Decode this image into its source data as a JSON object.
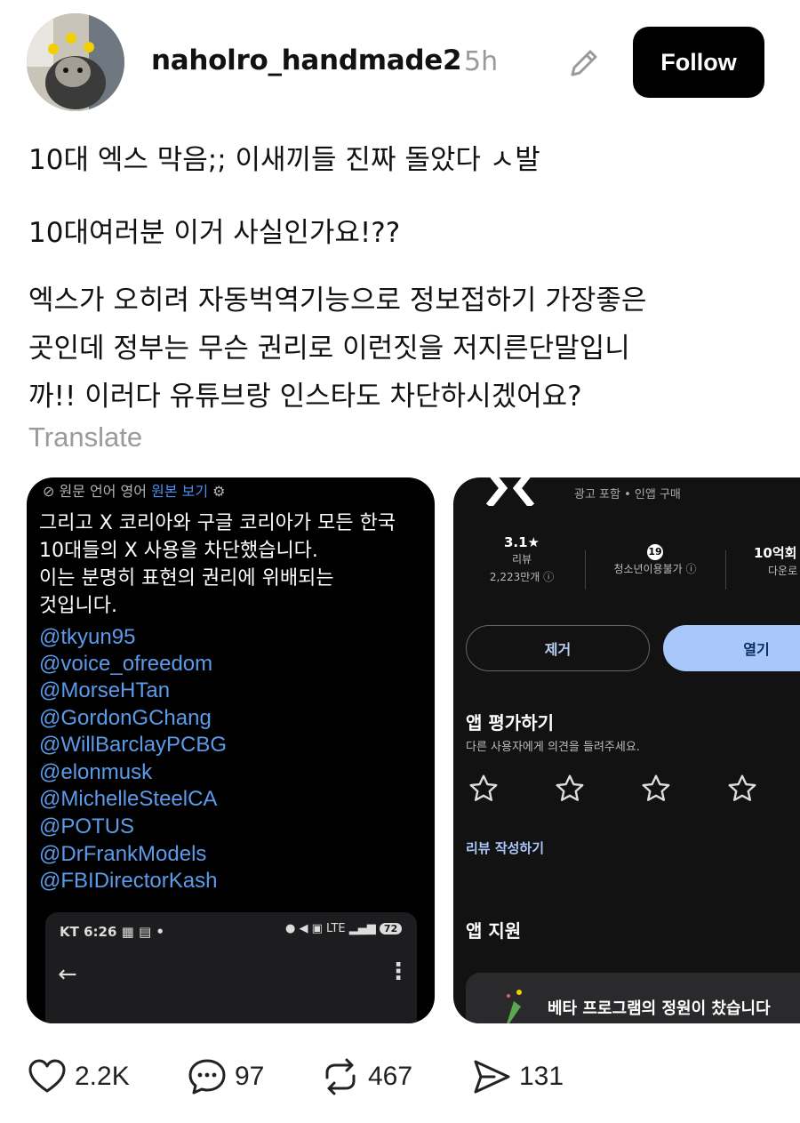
{
  "post": {
    "username": "naholro_handmade2",
    "time": "5h",
    "follow_label": "Follow",
    "lines": [
      "10대 엑스 막음;; 이새끼들 진짜 돌았다 ㅅ발",
      "10대여러분 이거 사실인가요!??"
    ],
    "paragraph": [
      "엑스가 오히려 자동벅역기능으로 정보접하기 가장좋은",
      "곳인데 정부는 무슨 권리로 이런짓을 저지른단말입니",
      "까!! 이러다 유튜브랑 인스타도 차단하시겠어요?"
    ],
    "translate_label": "Translate"
  },
  "card1": {
    "top_prefix": "원문 언어 영어",
    "top_link": "원본 보기",
    "text_lines": [
      "그리고 X 코리아와 구글 코리아가 모든 한국",
      "10대들의 X 사용을 차단했습니다.",
      "이는 분명히 표현의 권리에 위배되는",
      "것입니다."
    ],
    "mentions": [
      "@tkyun95",
      "@voice_ofreedom",
      "@MorseHTan",
      "@GordonGChang",
      "@WillBarclayPCBG",
      "@elonmusk",
      "@MichelleSteelCA",
      "@POTUS",
      "@DrFrankModels",
      "@FBIDirectorKash"
    ],
    "status_left": "KT 6:26",
    "status_network": "LTE",
    "battery": "72"
  },
  "card2": {
    "ad_text": "광고 포함 • 인앱 구매",
    "rating": "3.1★",
    "rating_label": "리뷰",
    "rating_count": "2,223만개 ⓘ",
    "age_badge": "19",
    "age_label": "청소년이용불가 ⓘ",
    "downloads": "10억회",
    "downloads_label": "다운로",
    "remove_label": "제거",
    "open_label": "열기",
    "rate_title": "앱 평가하기",
    "rate_subtitle": "다른 사용자에게 의견을 들려주세요.",
    "write_review": "리뷰 작성하기",
    "support_title": "앱 지원",
    "beta_text": "베타 프로그램의 정원이 찼습니다"
  },
  "footer": {
    "likes": "2.2K",
    "comments": "97",
    "reposts": "467",
    "shares": "131"
  }
}
